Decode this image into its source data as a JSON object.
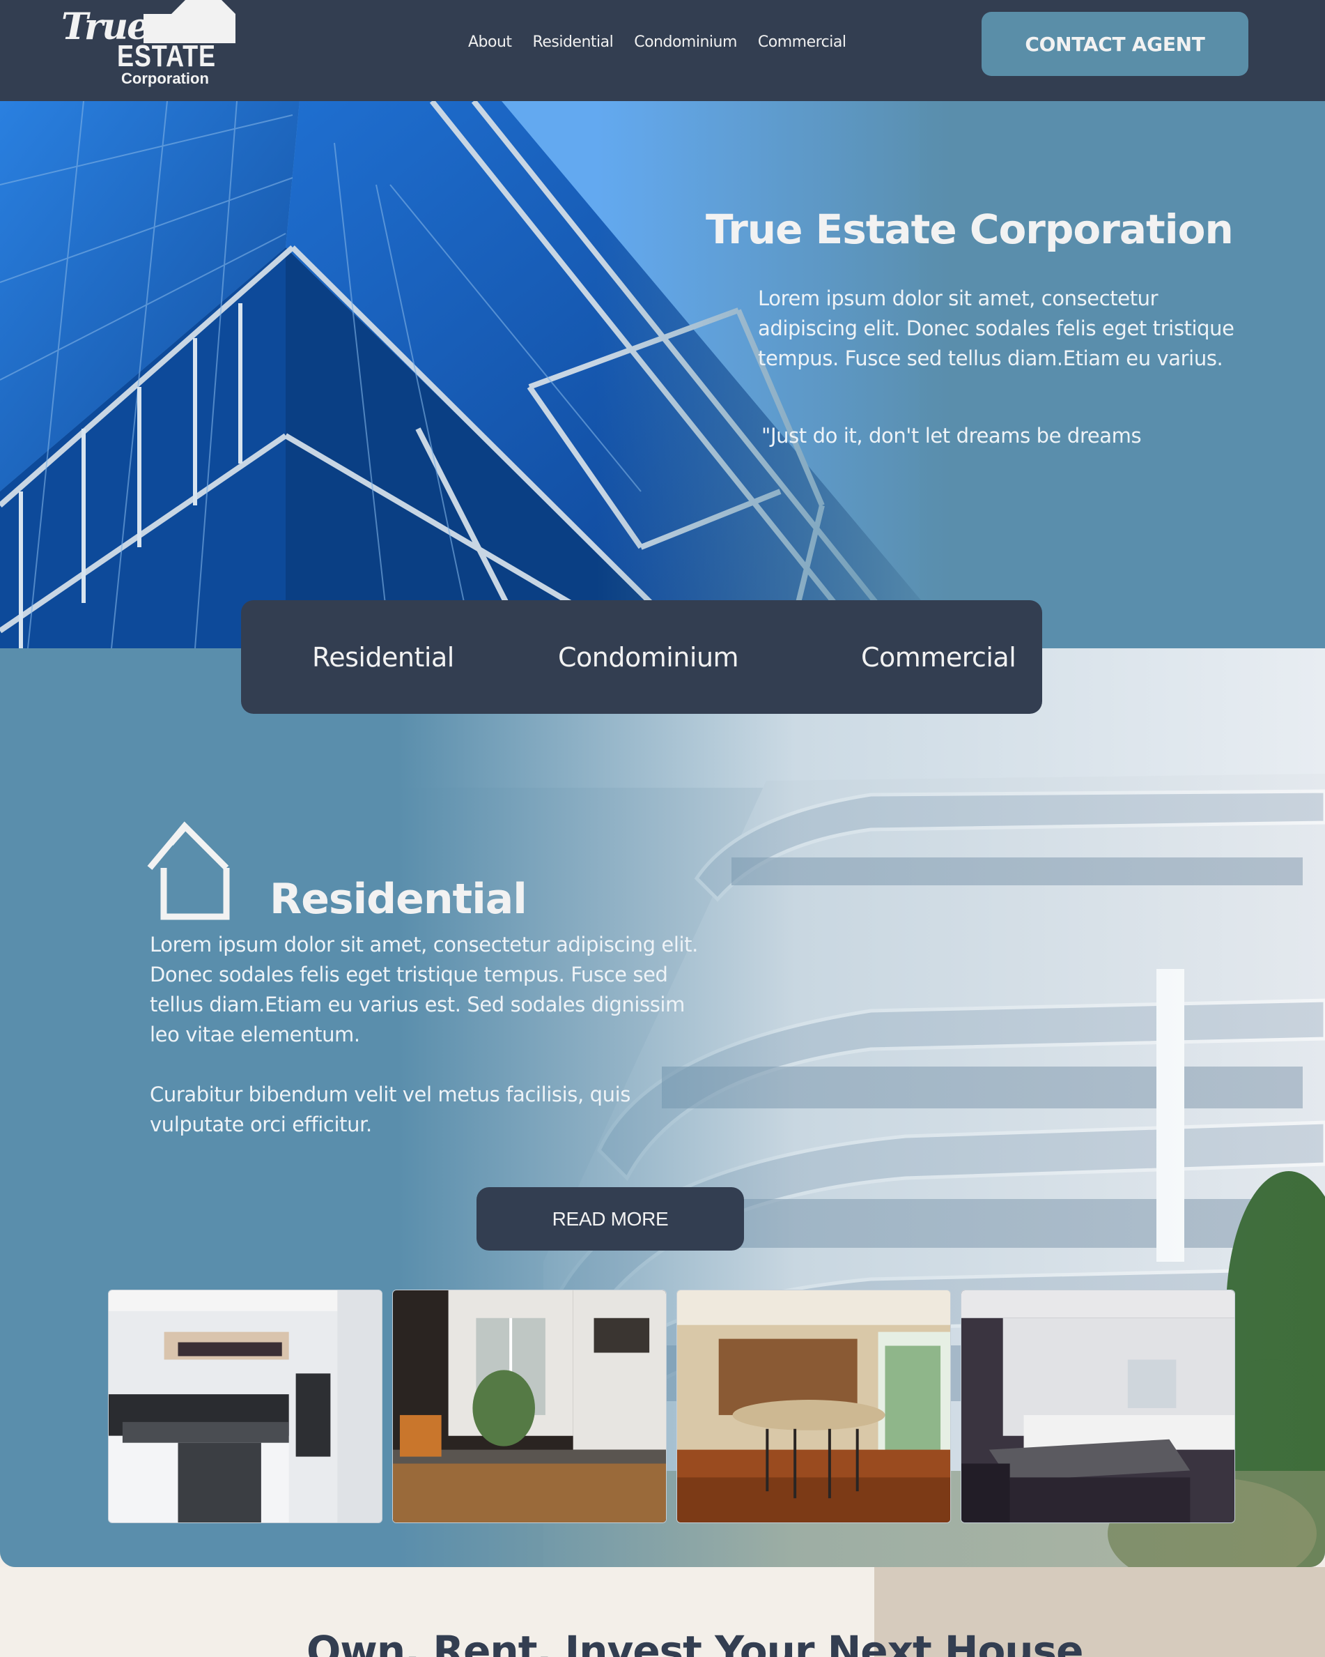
{
  "header": {
    "logo": {
      "line1": "True",
      "line2": "ESTATE",
      "line3": "Corporation"
    },
    "nav": [
      "About",
      "Residential",
      "Condominium",
      "Commercial"
    ],
    "contact_label": "CONTACT AGENT"
  },
  "hero": {
    "title": "True Estate Corporation",
    "text": "Lorem ipsum dolor sit amet, consectetur adipiscing elit. Donec sodales felis eget tristique tempus. Fusce sed tellus diam.Etiam eu varius.",
    "quote": "\"Just do it, don't let dreams be dreams"
  },
  "tabs": [
    "Residential",
    "Condominium",
    "Commercial"
  ],
  "residential": {
    "icon": "house-icon",
    "title": "Residential",
    "paragraph1": "Lorem ipsum dolor sit amet, consectetur adipiscing elit. Donec sodales felis eget tristique tempus. Fusce sed  tellus diam.Etiam eu varius est. Sed sodales dignissim leo vitae elementum.",
    "paragraph2": "Curabitur bibendum velit vel metus facilisis, quis vulputate orci efficitur.",
    "read_more": "READ MORE",
    "gallery": [
      "white-modern-kitchen-photo",
      "wooden-kitchen-window-photo",
      "open-kitchen-island-photo",
      "dark-kitchen-island-photo"
    ]
  },
  "section2": {
    "title": "Own, Rent, Invest Your Next House"
  },
  "colors": {
    "header_bg": "#333e51",
    "accent": "#5a8ea8",
    "section_bg": "#5a8eac",
    "text_light": "#f2f2f2"
  }
}
